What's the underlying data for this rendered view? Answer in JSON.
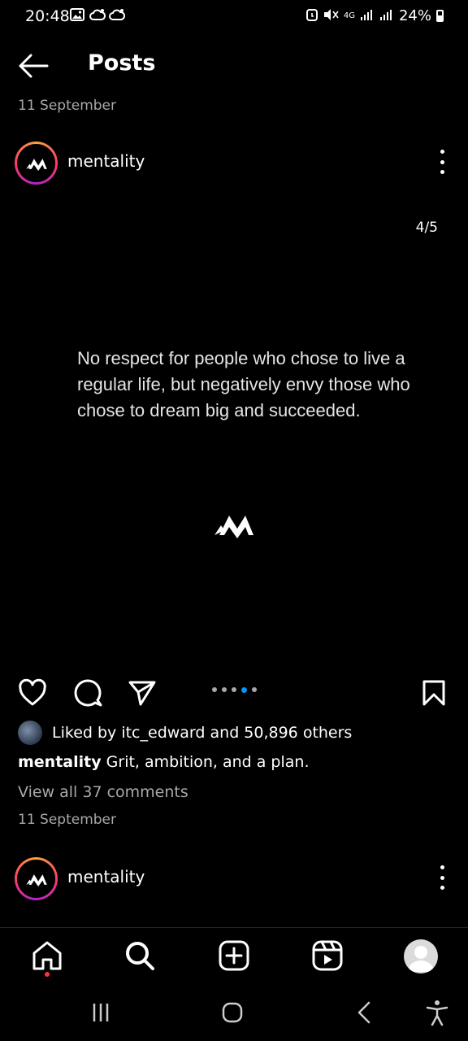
{
  "status_bar": {
    "time": "20:48",
    "left_icons": [
      "gallery-icon",
      "cloud-icon",
      "cloud-icon"
    ],
    "network": "4G",
    "battery": "24%"
  },
  "header": {
    "title": "Posts"
  },
  "posts": [
    {
      "date": "11 September",
      "username": "mentality",
      "slide_counter": "4/5",
      "slide_text": "No respect for people who chose to live a regular life, but negatively envy those who chose to dream big and succeeded.",
      "carousel": {
        "total": 5,
        "active_index": 3
      },
      "liked_by": "Liked by itc_edward and 50,896 others",
      "caption_user": "mentality",
      "caption_text": "Grit, ambition, and a plan.",
      "view_comments": "View all 37 comments",
      "posted_date": "11 September"
    },
    {
      "username": "mentality"
    }
  ],
  "bottom_nav": [
    "home-icon",
    "search-icon",
    "create-icon",
    "reels-icon",
    "profile-avatar"
  ],
  "system_nav": [
    "recents-icon",
    "home-button-icon",
    "back-icon",
    "accessibility-icon"
  ],
  "colors": {
    "background": "#000000",
    "secondary_text": "#a8a8a8",
    "accent_blue": "#0095f6",
    "notification_red": "#ff3040"
  }
}
